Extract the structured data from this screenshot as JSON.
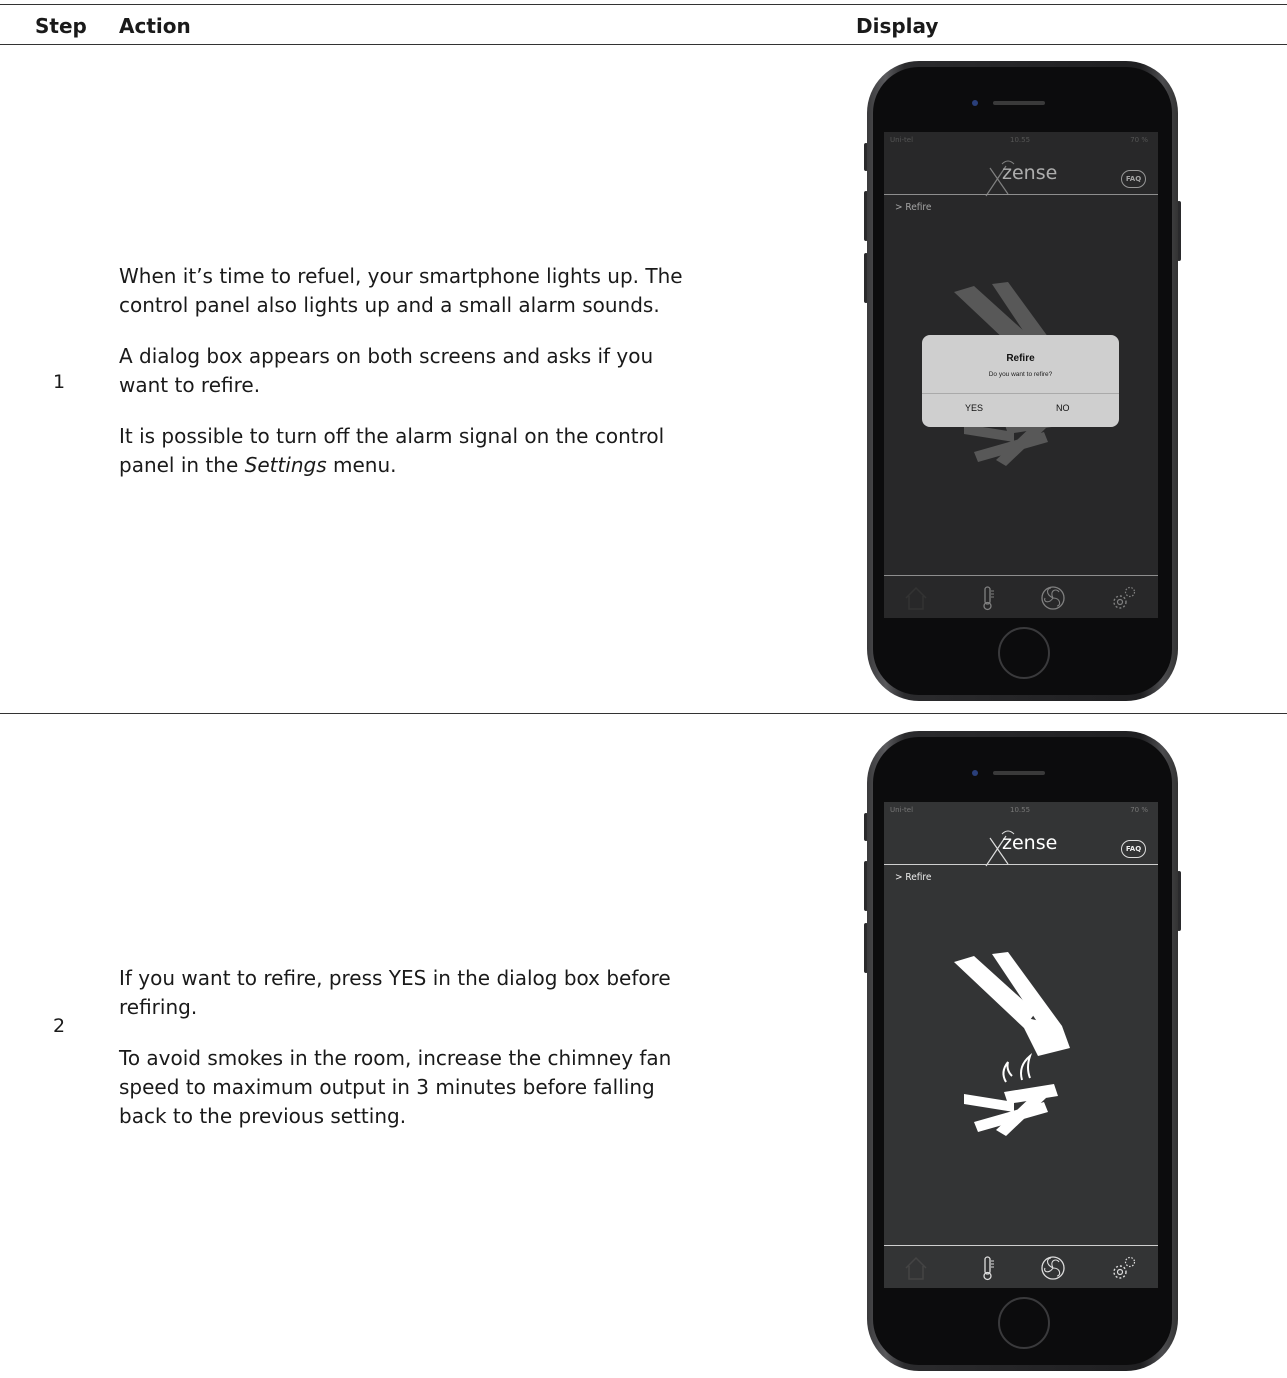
{
  "table": {
    "headers": {
      "step": "Step",
      "action": "Action",
      "display": "Display"
    },
    "rows": [
      {
        "step": "1",
        "paragraphs": [
          "When it’s time to refuel, your smartphone lights up. The control panel also lights up and a small alarm sounds.",
          "A dialog box appears on both screens and asks if you want to refire."
        ],
        "p3_before": "It is possible to turn off the alarm signal on the control panel in the ",
        "p3_italic": "Settings",
        "p3_after": " menu.",
        "phone": {
          "status_left": "Uni-tel",
          "status_time": "10.55",
          "status_right": "70 %",
          "logo": "zense",
          "faq": "FAQ",
          "breadcrumb": "> Refire",
          "dialog": {
            "title": "Refire",
            "message": "Do you want to refire?",
            "yes": "YES",
            "no": "NO"
          }
        }
      },
      {
        "step": "2",
        "paragraphs": [
          "If you want to refire, press YES in the dialog box before refiring.",
          "To avoid smokes in the room, increase the chimney fan speed to maximum output in 3 minutes before falling back to the previous setting."
        ],
        "phone": {
          "status_left": "Uni-tel",
          "status_time": "10.55",
          "status_right": "70 %",
          "logo": "zense",
          "faq": "FAQ",
          "breadcrumb": "> Refire"
        }
      }
    ]
  }
}
